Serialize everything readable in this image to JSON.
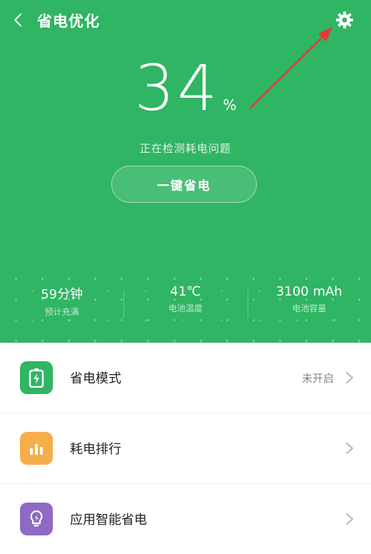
{
  "header": {
    "title": "省电优化",
    "back_icon": "chevron-left-icon",
    "settings_icon": "gear-icon"
  },
  "battery": {
    "percent": "34",
    "unit": "%",
    "status": "正在检测耗电问题",
    "action_label": "一键省电"
  },
  "stats": [
    {
      "value": "59分钟",
      "label": "预计充满"
    },
    {
      "value": "41℃",
      "label": "电池温度"
    },
    {
      "value": "3100 mAh",
      "label": "电池容量"
    }
  ],
  "menu": [
    {
      "label": "省电模式",
      "value": "未开启",
      "icon": "battery-bolt-icon",
      "color": "#2fb563"
    },
    {
      "label": "耗电排行",
      "value": "",
      "icon": "bar-chart-icon",
      "color": "#f7ad4a"
    },
    {
      "label": "应用智能省电",
      "value": "",
      "icon": "lightbulb-icon",
      "color": "#8e6ac4"
    }
  ],
  "colors": {
    "hero_background": "#2fb563",
    "annotation_arrow": "#e53935"
  }
}
